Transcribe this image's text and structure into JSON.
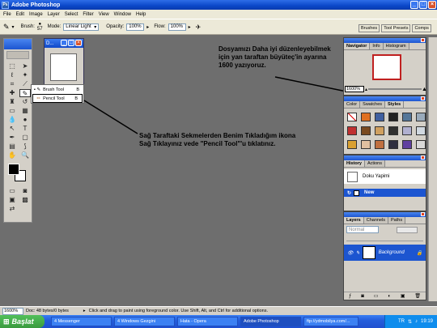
{
  "app": {
    "title": "Adobe Photoshop"
  },
  "menu": [
    "File",
    "Edit",
    "Image",
    "Layer",
    "Select",
    "Filter",
    "View",
    "Window",
    "Help"
  ],
  "options": {
    "brush_label": "Brush:",
    "brush_size": "57",
    "mode_label": "Mode:",
    "mode_value": "Linear Light",
    "opacity_label": "Opacity:",
    "opacity_value": "100%",
    "flow_label": "Flow:",
    "flow_value": "100%"
  },
  "panel_well": [
    "Brushes",
    "Tool Presets",
    "Comps"
  ],
  "doc_window": {
    "title": "D..."
  },
  "flyout": [
    {
      "label": "Brush Tool",
      "key": "B"
    },
    {
      "label": "Pencil Tool",
      "key": "B"
    }
  ],
  "annotations": {
    "top": "Dosyamızı Daha iyi düzenleyebilmek için yan taraftan büyüteç'in ayarına 1600 yazıyoruz.",
    "middle": "Sağ Taraftaki Sekmelerden Benim Tıkladığım ikona Sağ Tıklayınız vede \"Pencil Tool\"'u tıklatınız."
  },
  "navigator": {
    "tabs": [
      "Navigator",
      "Info",
      "Histogram"
    ],
    "zoom": "1600%"
  },
  "swatches": {
    "tabs": [
      "Color",
      "Swatches",
      "Styles"
    ]
  },
  "history": {
    "tabs": [
      "History",
      "Actions"
    ],
    "items": [
      "Doku Yapimi",
      "New"
    ]
  },
  "layers": {
    "tabs": [
      "Layers",
      "Channels",
      "Paths"
    ],
    "blend": "Normal",
    "layer_name": "Background"
  },
  "statusbar": {
    "zoom": "1600%",
    "doc": "Doc: 48 bytes/0 bytes",
    "hint": "Click and drag to paint using foreground color.  Use Shift, Alt, and Ctrl for additional options."
  },
  "taskbar": {
    "start": "Başlat",
    "tasks": [
      "4 Messenger",
      "4 Windows Gezgini",
      "Hata - Opera",
      "Adobe Photoshop",
      "ftp://ydmobilya.com/..."
    ],
    "lang": "TR",
    "clock": "19:19"
  }
}
